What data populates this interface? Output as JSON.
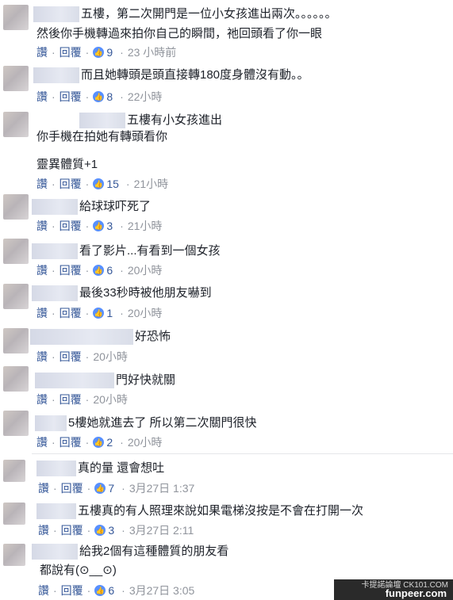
{
  "actions": {
    "like": "讚",
    "reply": "回覆"
  },
  "comments": [
    {
      "lines": [
        "五樓，第二次開門是一位小女孩進出兩次。。。。。。",
        "然後你手機轉過來拍你自己的瞬間，祂回頭看了你一眼"
      ],
      "likes": "9",
      "time": "23 小時前"
    },
    {
      "lines": [
        "而且她轉頭是頭直接轉180度身體沒有動。。"
      ],
      "likes": "8",
      "time": "22小時"
    },
    {
      "lines": [
        "五樓有小女孩進出",
        "你手機在拍她有轉頭看你",
        "靈異體質+1"
      ],
      "likes": "15",
      "time": "21小時"
    },
    {
      "lines": [
        "給球球吓死了"
      ],
      "likes": "3",
      "time": "21小時"
    },
    {
      "lines": [
        "看了影片...有看到一個女孩"
      ],
      "likes": "6",
      "time": "20小時"
    },
    {
      "lines": [
        "最後33秒時被他朋友嚇到"
      ],
      "likes": "1",
      "time": "20小時"
    },
    {
      "lines": [
        "好恐怖"
      ],
      "likes": "",
      "time": "20小時"
    },
    {
      "lines": [
        "門好快就關"
      ],
      "likes": "",
      "time": "20小時"
    },
    {
      "lines": [
        "5樓她就進去了 所以第二次關門很快"
      ],
      "likes": "2",
      "time": "20小時"
    },
    {
      "lines": [
        "真的量 還會想吐"
      ],
      "likes": "7",
      "time": "3月27日 1:37"
    },
    {
      "lines": [
        "五樓真的有人照理來說如果電梯沒按是不會在打開一次"
      ],
      "likes": "3",
      "time": "3月27日 2:11"
    },
    {
      "lines": [
        "給我2個有這種體質的朋友看",
        "都說有(⊙__⊙)"
      ],
      "likes": "6",
      "time": "3月27日 3:05"
    }
  ],
  "watermark": {
    "top": "卡提諾論壇 CK101.COM",
    "main": "funpeer.com"
  },
  "colors": {
    "link": "#365899",
    "like": "#5890ff",
    "time": "#90949c"
  }
}
